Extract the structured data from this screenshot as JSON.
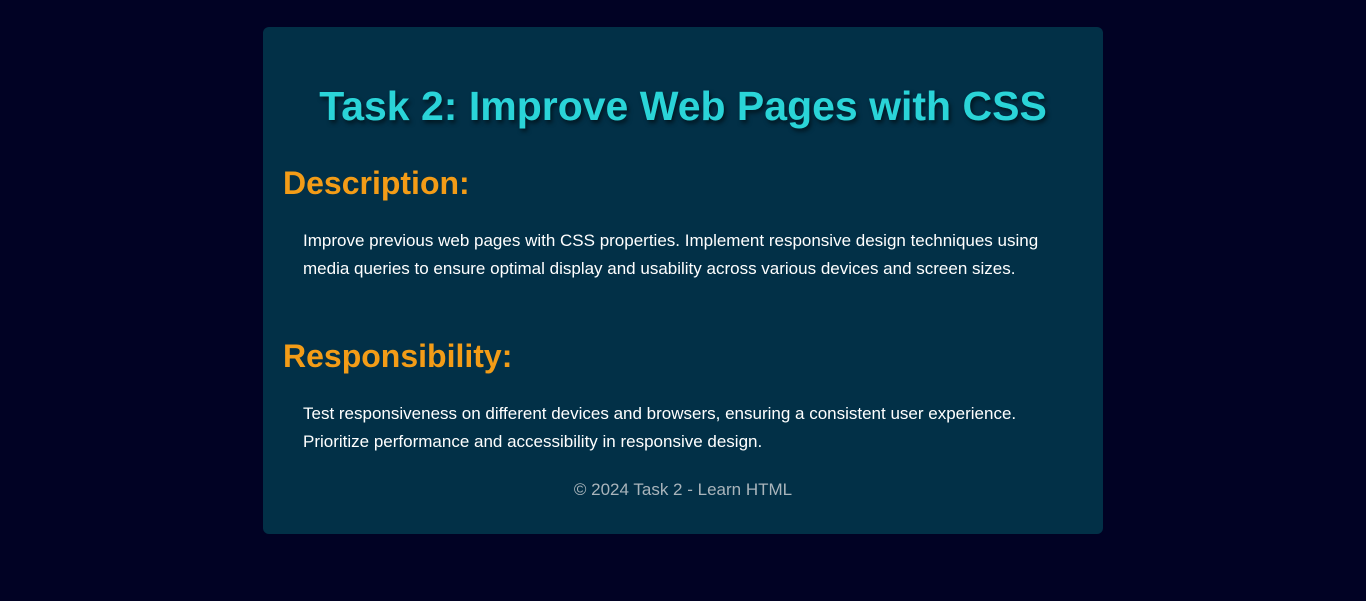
{
  "page": {
    "title": "Task 2: Improve Web Pages with CSS"
  },
  "sections": [
    {
      "heading": "Description:",
      "text": "Improve previous web pages with CSS properties. Implement responsive design techniques using media queries to ensure optimal display and usability across various devices and screen sizes."
    },
    {
      "heading": "Responsibility:",
      "text": "Test responsiveness on different devices and browsers, ensuring a consistent user experience. Prioritize performance and accessibility in responsive design."
    }
  ],
  "footer": {
    "text": "© 2024 Task 2 - Learn HTML"
  },
  "colors": {
    "background": "#010224",
    "card": "#023047",
    "title": "#2ad4d8",
    "heading": "#f39c17",
    "body_text": "#ffffff",
    "footer_text": "#a9b4bb"
  }
}
